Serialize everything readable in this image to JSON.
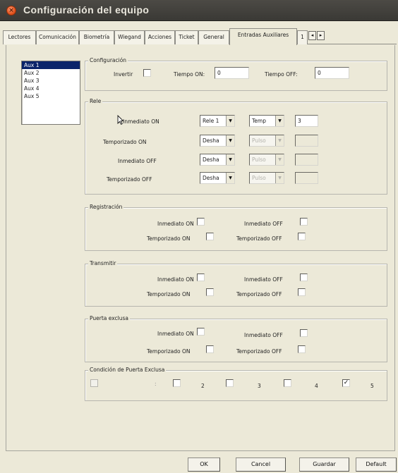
{
  "window": {
    "title": "Configuración del equipo",
    "close_glyph": "×"
  },
  "tabs": [
    {
      "label": "Lectores"
    },
    {
      "label": "Comunicación"
    },
    {
      "label": "Biometría"
    },
    {
      "label": "Wiegand"
    },
    {
      "label": "Acciones"
    },
    {
      "label": "Ticket"
    },
    {
      "label": "General"
    },
    {
      "label": "Entradas Auxiliares"
    },
    {
      "label": "1"
    }
  ],
  "tab_scroll": {
    "left": "◂",
    "right": "▸"
  },
  "aux_list": {
    "items": [
      "Aux 1",
      "Aux 2",
      "Aux 3",
      "Aux 4",
      "Aux 5"
    ],
    "selected": "Aux 1"
  },
  "configuracion": {
    "legend": "Configuración",
    "invertir_label": "Invertir",
    "tiempo_on_label": "Tiempo ON:",
    "tiempo_on_value": "0",
    "tiempo_off_label": "Tiempo OFF:",
    "tiempo_off_value": "0"
  },
  "rele": {
    "legend": "Rele",
    "rows": [
      {
        "label": "Inmediato ON",
        "combo1": "Rele 1",
        "combo2": "Temp",
        "value": "3"
      },
      {
        "label": "Temporizado ON",
        "combo1": "Desha",
        "combo2": "Pulso",
        "value": ""
      },
      {
        "label": "Inmediato OFF",
        "combo1": "Desha",
        "combo2": "Pulso",
        "value": ""
      },
      {
        "label": "Temporizado OFF",
        "combo1": "Desha",
        "combo2": "Pulso",
        "value": ""
      }
    ]
  },
  "registracion": {
    "legend": "Registración",
    "inmediato_on": "Inmediato ON",
    "inmediato_off": "Inmediato OFF",
    "temporizado_on": "Temporizado ON",
    "temporizado_off": "Temporizado OFF"
  },
  "transmitir": {
    "legend": "Transmitir",
    "inmediato_on": "Inmediato ON",
    "inmediato_off": "Inmediato OFF",
    "temporizado_on": "Temporizado ON",
    "temporizado_off": "Temporizado OFF"
  },
  "puerta_exclusa": {
    "legend": "Puerta exclusa",
    "inmediato_on": "Inmediato ON",
    "inmediato_off": "Inmediato OFF",
    "temporizado_on": "Temporizado ON",
    "temporizado_off": "Temporizado OFF"
  },
  "condicion": {
    "legend": "Condición de Puerta Exclusa",
    "items": [
      {
        "label": "",
        "checked": false
      },
      {
        "label": "",
        "checked": false
      },
      {
        "label": "2",
        "checked": false
      },
      {
        "label": "3",
        "checked": false
      },
      {
        "label": "4",
        "checked": false
      },
      {
        "label": "5",
        "checked": true
      }
    ],
    "check_glyph": "✓"
  },
  "buttons": {
    "ok": "OK",
    "cancel": "Cancel",
    "save": "Guardar",
    "default": "Default"
  },
  "icons": {
    "close": "close-icon",
    "dropdown": "chevron-down-icon",
    "cursor": "mouse-pointer-icon"
  },
  "colors": {
    "selection": "#0a246a",
    "close_button": "#e2541f",
    "titlebar": "#3c3b37"
  }
}
